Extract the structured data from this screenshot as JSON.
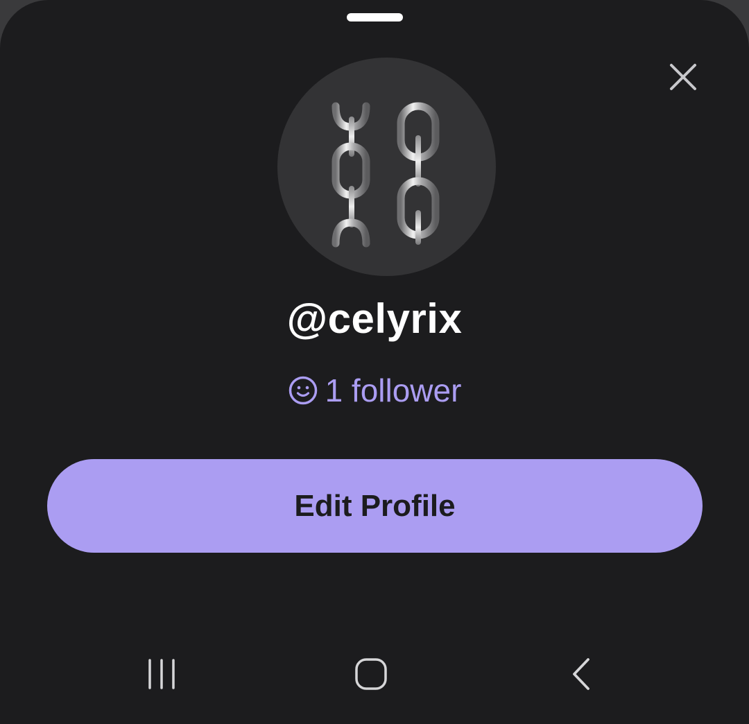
{
  "profile": {
    "username": "@celyrix",
    "followers_label": "1 follower",
    "avatar_icon": "chain-links-icon"
  },
  "actions": {
    "edit_profile_label": "Edit Profile",
    "close_icon": "close-icon"
  },
  "nav": {
    "recents_icon": "recents-icon",
    "home_icon": "home-icon",
    "back_icon": "back-icon"
  },
  "colors": {
    "background": "#1c1c1e",
    "accent": "#ab9df2",
    "avatar_bg": "#333335",
    "text_primary": "#ffffff"
  }
}
